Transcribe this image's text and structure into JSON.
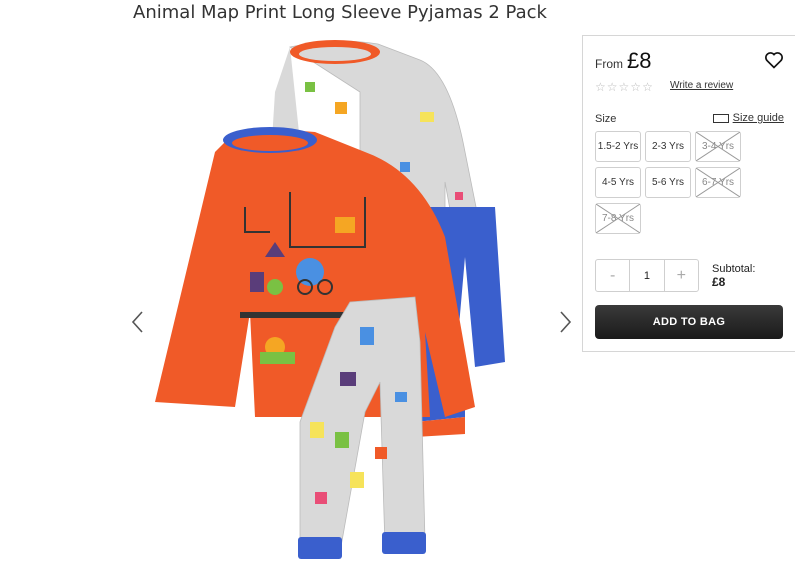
{
  "product": {
    "title": "Animal Map Print Long Sleeve Pyjamas 2 Pack",
    "from_label": "From",
    "price": "£8",
    "review_link": "Write a review",
    "rating_stars": 0
  },
  "size": {
    "label": "Size",
    "guide_link": "Size guide",
    "options": [
      {
        "label": "1.5-2 Yrs",
        "available": true
      },
      {
        "label": "2-3 Yrs",
        "available": true
      },
      {
        "label": "3-4 Yrs",
        "available": false
      },
      {
        "label": "4-5 Yrs",
        "available": true
      },
      {
        "label": "5-6 Yrs",
        "available": true
      },
      {
        "label": "6-7 Yrs",
        "available": false
      },
      {
        "label": "7-8 Yrs",
        "available": false
      }
    ]
  },
  "quantity": {
    "minus": "-",
    "value": "1",
    "plus": "+"
  },
  "subtotal": {
    "label": "Subtotal:",
    "value": "£8"
  },
  "cta": {
    "add_to_bag": "ADD TO BAG"
  },
  "icons": {
    "prev": "chevron-left-icon",
    "next": "chevron-right-icon",
    "wishlist": "heart-icon",
    "size_guide": "ruler-icon"
  },
  "colors": {
    "top_orange": "#f05a28",
    "trim_blue": "#3a5fcd",
    "print_grey": "#d9d9d9",
    "button_dark": "#222222"
  }
}
